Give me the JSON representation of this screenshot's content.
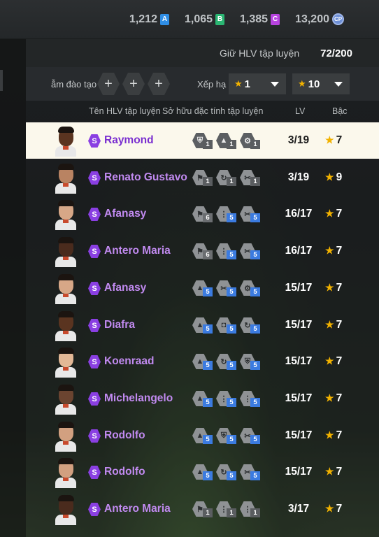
{
  "currencies": [
    {
      "value": "1,212",
      "badge": "A",
      "color": "#2f8ee6"
    },
    {
      "value": "1,065",
      "badge": "B",
      "color": "#2bb673"
    },
    {
      "value": "1,385",
      "badge": "C",
      "color": "#b843e0"
    },
    {
      "value": "13,200",
      "badge": "CP",
      "color": "#6d8fd6"
    }
  ],
  "holder": {
    "label": "Giữ HLV tập luyện",
    "value": "72/200"
  },
  "filters": {
    "training_label": "ẫm đào tạo",
    "plus_symbol": "+",
    "rank_label": "Xếp hạ",
    "rank_from": "1",
    "rank_to": "10",
    "separator": "~"
  },
  "table_headers": {
    "name": "Tên HLV tập luyện",
    "skills": "Sở hữu đặc tính tập luyện",
    "lv": "LV",
    "grade": "Bậc"
  },
  "rows": [
    {
      "name": "Raymond",
      "badge": "S",
      "levels": [
        "1",
        "1",
        "1"
      ],
      "icons": [
        "shield-icon",
        "cap-icon",
        "gear-icon"
      ],
      "lv": "3/19",
      "grade": "7",
      "selected": true,
      "skin": "#5a3420"
    },
    {
      "name": "Renato Gustavo",
      "badge": "S",
      "levels": [
        "1",
        "1",
        "1"
      ],
      "icons": [
        "whistle-icon",
        "refresh-icon",
        "tools-icon"
      ],
      "lv": "3/19",
      "grade": "9",
      "selected": false,
      "skin": "#b98362"
    },
    {
      "name": "Afanasy",
      "badge": "S",
      "levels": [
        "6",
        "5",
        "5"
      ],
      "icons": [
        "whistle-icon",
        "tie-icon",
        "tools-icon"
      ],
      "lv": "16/17",
      "grade": "7",
      "selected": false,
      "skin": "#d7a787"
    },
    {
      "name": "Antero Maria",
      "badge": "S",
      "levels": [
        "6",
        "5",
        "5"
      ],
      "icons": [
        "whistle-icon",
        "tie-icon",
        "tools-icon"
      ],
      "lv": "16/17",
      "grade": "7",
      "selected": false,
      "skin": "#4a2b1d"
    },
    {
      "name": "Afanasy",
      "badge": "S",
      "levels": [
        "5",
        "5",
        "5"
      ],
      "icons": [
        "cap-icon",
        "tools-icon",
        "gear-icon"
      ],
      "lv": "15/17",
      "grade": "7",
      "selected": false,
      "skin": "#d7a787"
    },
    {
      "name": "Diafra",
      "badge": "S",
      "levels": [
        "5",
        "5",
        "5"
      ],
      "icons": [
        "cap-icon",
        "lock-icon",
        "refresh-icon"
      ],
      "lv": "15/17",
      "grade": "7",
      "selected": false,
      "skin": "#5a3420"
    },
    {
      "name": "Koenraad",
      "badge": "S",
      "levels": [
        "5",
        "5",
        "5"
      ],
      "icons": [
        "cap-icon",
        "refresh-icon",
        "shield-icon"
      ],
      "lv": "15/17",
      "grade": "7",
      "selected": false,
      "skin": "#e3b896"
    },
    {
      "name": "Michelangelo",
      "badge": "S",
      "levels": [
        "5",
        "5",
        "5"
      ],
      "icons": [
        "cap-icon",
        "tie-icon",
        "tie-icon"
      ],
      "lv": "15/17",
      "grade": "7",
      "selected": false,
      "skin": "#6b4430"
    },
    {
      "name": "Rodolfo",
      "badge": "S",
      "levels": [
        "5",
        "5",
        "5"
      ],
      "icons": [
        "cap-icon",
        "shield-icon",
        "tools-icon"
      ],
      "lv": "15/17",
      "grade": "7",
      "selected": false,
      "skin": "#d2a080"
    },
    {
      "name": "Rodolfo",
      "badge": "S",
      "levels": [
        "5",
        "5",
        "5"
      ],
      "icons": [
        "cap-icon",
        "refresh-icon",
        "tools-icon"
      ],
      "lv": "15/17",
      "grade": "7",
      "selected": false,
      "skin": "#d2a080"
    },
    {
      "name": "Antero Maria",
      "badge": "S",
      "levels": [
        "1",
        "1",
        "1"
      ],
      "icons": [
        "whistle-icon",
        "tie-icon",
        "tie-icon"
      ],
      "lv": "3/17",
      "grade": "7",
      "selected": false,
      "skin": "#4a2b1d"
    }
  ]
}
